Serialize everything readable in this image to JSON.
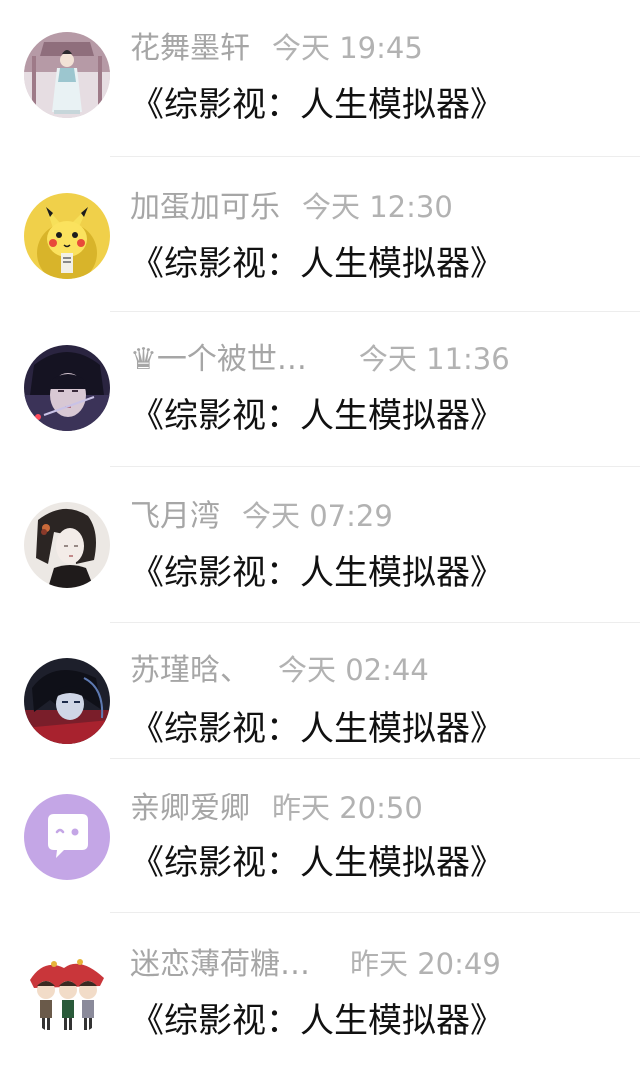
{
  "conversations": [
    {
      "name": "花舞墨轩",
      "time": "今天 19:45",
      "message": "《综影视：人生模拟器》",
      "avatar": "ancient-robe-figure"
    },
    {
      "name": "加蛋加可乐",
      "time": "今天 12:30",
      "message": "《综影视：人生模拟器》",
      "avatar": "pikachu"
    },
    {
      "name": "♛一个被世…",
      "time": "今天 11:36",
      "message": "《综影视：人生模拟器》",
      "avatar": "dark-anime-boy"
    },
    {
      "name": "飞月湾",
      "time": "今天 07:29",
      "message": "《综影视：人生模拟器》",
      "avatar": "girl-profile"
    },
    {
      "name": "苏瑾晗、",
      "time": "今天 02:44",
      "message": "《综影视：人生模拟器》",
      "avatar": "anime-character-red"
    },
    {
      "name": "亲卿爱卿",
      "time": "昨天 20:50",
      "message": "《综影视：人生模拟器》",
      "avatar": "chat-bubble-icon"
    },
    {
      "name": "迷恋薄荷糖…",
      "time": "昨天 20:49",
      "message": "《综影视：人生模拟器》",
      "avatar": "chibi-group"
    }
  ],
  "colors": {
    "name_text": "#a6a6a6",
    "time_text": "#b2b2b2",
    "message_text": "#111111",
    "divider": "#ededed",
    "bubble_avatar_bg": "#c4a6e6"
  }
}
